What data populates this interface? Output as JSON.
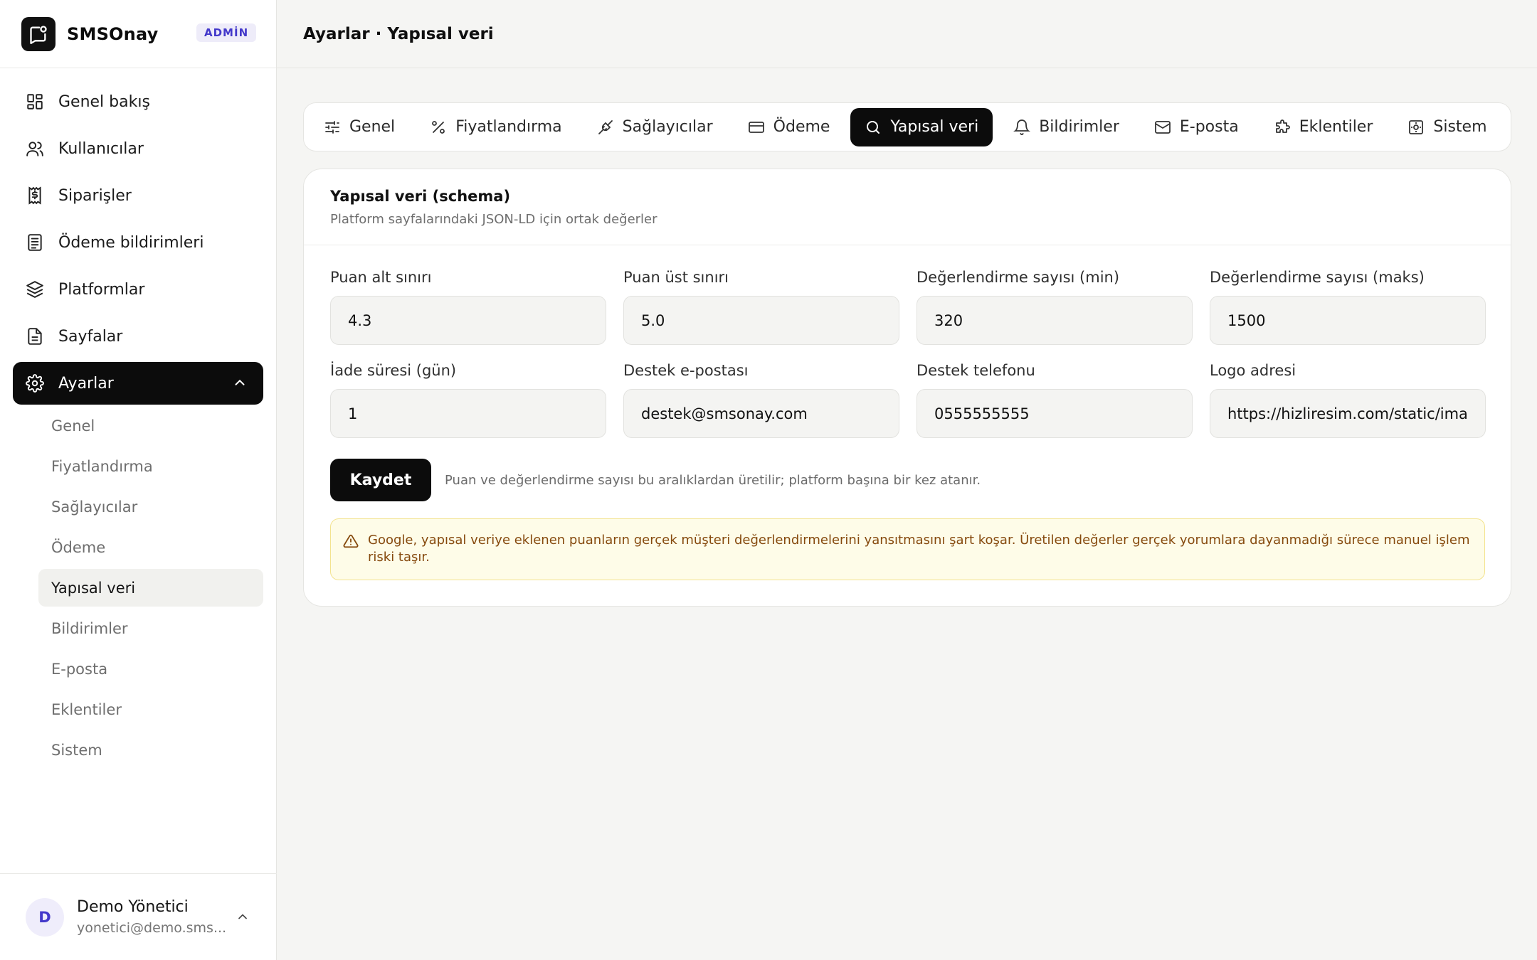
{
  "brand": {
    "name": "SMSOnay",
    "badge": "ADMİN"
  },
  "header": {
    "title": "Ayarlar · Yapısal veri"
  },
  "sidebar": {
    "items": [
      {
        "label": "Genel bakış",
        "icon": "dashboard-icon"
      },
      {
        "label": "Kullanıcılar",
        "icon": "users-icon"
      },
      {
        "label": "Siparişler",
        "icon": "receipt-icon"
      },
      {
        "label": "Ödeme bildirimleri",
        "icon": "document-list-icon"
      },
      {
        "label": "Platformlar",
        "icon": "layers-icon"
      },
      {
        "label": "Sayfalar",
        "icon": "file-icon"
      },
      {
        "label": "Ayarlar",
        "icon": "gear-icon",
        "active": true
      }
    ],
    "sub_items": [
      {
        "label": "Genel"
      },
      {
        "label": "Fiyatlandırma"
      },
      {
        "label": "Sağlayıcılar"
      },
      {
        "label": "Ödeme"
      },
      {
        "label": "Yapısal veri",
        "active": true
      },
      {
        "label": "Bildirimler"
      },
      {
        "label": "E-posta"
      },
      {
        "label": "Eklentiler"
      },
      {
        "label": "Sistem"
      }
    ]
  },
  "user": {
    "initial": "D",
    "name": "Demo Yönetici",
    "email": "yonetici@demo.sms..."
  },
  "tabs": [
    {
      "label": "Genel",
      "icon": "sliders-icon"
    },
    {
      "label": "Fiyatlandırma",
      "icon": "percent-icon"
    },
    {
      "label": "Sağlayıcılar",
      "icon": "plug-icon"
    },
    {
      "label": "Ödeme",
      "icon": "credit-card-icon"
    },
    {
      "label": "Yapısal veri",
      "icon": "search-icon",
      "active": true
    },
    {
      "label": "Bildirimler",
      "icon": "bell-icon"
    },
    {
      "label": "E-posta",
      "icon": "mail-icon"
    },
    {
      "label": "Eklentiler",
      "icon": "puzzle-icon"
    },
    {
      "label": "Sistem",
      "icon": "system-icon"
    }
  ],
  "card": {
    "title": "Yapısal veri (schema)",
    "subtitle": "Platform sayfalarındaki JSON-LD için ortak değerler"
  },
  "fields": [
    {
      "label": "Puan alt sınırı",
      "value": "4.3"
    },
    {
      "label": "Puan üst sınırı",
      "value": "5.0"
    },
    {
      "label": "Değerlendirme sayısı (min)",
      "value": "320"
    },
    {
      "label": "Değerlendirme sayısı (maks)",
      "value": "1500"
    },
    {
      "label": "İade süresi (gün)",
      "value": "1"
    },
    {
      "label": "Destek e-postası",
      "value": "destek@smsonay.com"
    },
    {
      "label": "Destek telefonu",
      "value": "0555555555"
    },
    {
      "label": "Logo adresi",
      "value": "https://hizliresim.com/static/ima"
    }
  ],
  "actions": {
    "save_label": "Kaydet",
    "save_hint": "Puan ve değerlendirme sayısı bu aralıklardan üretilir; platform başına bir kez atanır."
  },
  "alert": {
    "text": "Google, yapısal veriye eklenen puanların gerçek müşteri değerlendirmelerini yansıtmasını şart koşar. Üretilen değerler gerçek yorumlara dayanmadığı sürece manuel işlem riski taşır.",
    "icon": "warning-icon"
  },
  "colors": {
    "accent": "#0c0c0c",
    "badge": "#4338ca",
    "warning_bg": "#fefce8",
    "warning_text": "#864a0e"
  }
}
